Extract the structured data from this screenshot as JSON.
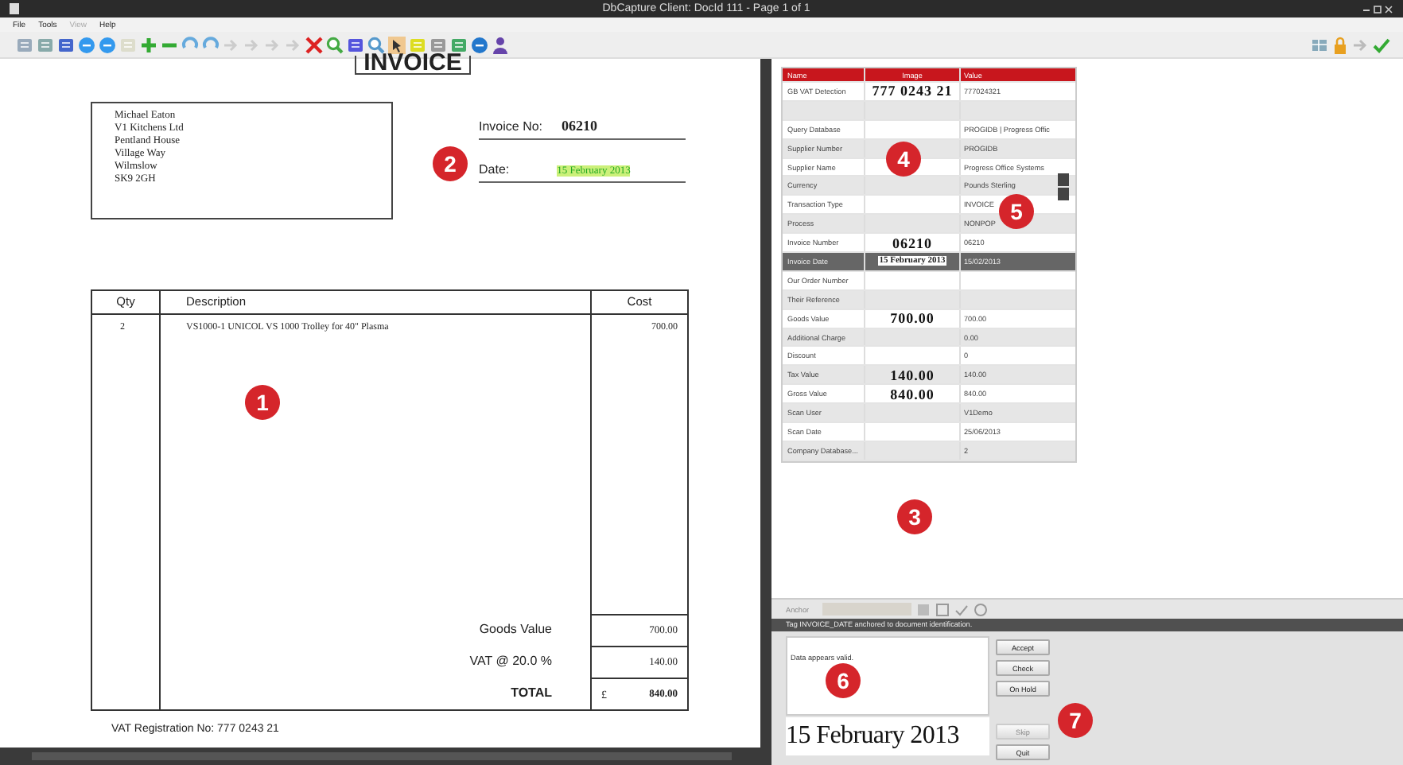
{
  "window": {
    "title": "DbCapture Client: DocId 111 - Page 1 of 1"
  },
  "menu": [
    {
      "label": "File",
      "disabled": false
    },
    {
      "label": "Tools",
      "disabled": false
    },
    {
      "label": "View",
      "disabled": true
    },
    {
      "label": "Help",
      "disabled": false
    }
  ],
  "invoice": {
    "heading": "INVOICE",
    "address": [
      "Michael Eaton",
      "V1 Kitchens Ltd",
      "Pentland House",
      "Village Way",
      "Wilmslow",
      "SK9 2GH"
    ],
    "invoice_no_label": "Invoice No:",
    "invoice_no": "06210",
    "date_label": "Date:",
    "date": "15 February 2013",
    "columns": [
      "Qty",
      "Description",
      "Cost"
    ],
    "rows": [
      {
        "qty": "2",
        "description": "VS1000-1  UNICOL VS 1000 Trolley for 40\" Plasma",
        "cost": "700.00"
      }
    ],
    "totals": [
      {
        "label": "Goods Value",
        "value": "700.00"
      },
      {
        "label": "VAT @ 20.0 %",
        "value": "140.00"
      },
      {
        "label": "TOTAL",
        "currency": "£",
        "value": "840.00"
      }
    ],
    "vat_registration": "VAT Registration No:  777 0243 21"
  },
  "grid": {
    "columns": [
      "Name",
      "Image",
      "Value"
    ],
    "rows": [
      {
        "name": "GB VAT Detection",
        "image": "777 0243 21",
        "value": "777024321",
        "selected": false
      },
      {
        "selected": false
      },
      {
        "name": "Query Database",
        "value": "PROGIDB  |  Progress Offic",
        "selected": false
      },
      {
        "name": "Supplier Number",
        "value": "PROGIDB",
        "selected": false
      },
      {
        "name": "Supplier Name",
        "value": "Progress Office Systems",
        "selected": false
      },
      {
        "name": "Currency",
        "value": "Pounds Sterling",
        "selected": false
      },
      {
        "name": "Transaction Type",
        "value": "INVOICE",
        "selected": false
      },
      {
        "name": "Process",
        "value": "NONPOP",
        "selected": false
      },
      {
        "name": "Invoice Number",
        "image": "06210",
        "value": "06210",
        "selected": false
      },
      {
        "name": "Invoice Date",
        "image": "15 February 2013",
        "value": "15/02/2013",
        "selected": true
      },
      {
        "name": "Our Order Number",
        "selected": false
      },
      {
        "name": "Their Reference",
        "selected": false
      },
      {
        "name": "Goods Value",
        "image": "700.00",
        "value": "700.00",
        "selected": false
      },
      {
        "name": "Additional Charge",
        "value": "0.00",
        "selected": false
      },
      {
        "name": "Discount",
        "value": "0",
        "selected": false
      },
      {
        "name": "Tax Value",
        "image": "140.00",
        "value": "140.00",
        "selected": false
      },
      {
        "name": "Gross Value",
        "image": "840.00",
        "value": "840.00",
        "selected": false
      },
      {
        "name": "Scan User",
        "value": "V1Demo",
        "selected": false
      },
      {
        "name": "Scan Date",
        "value": "25/06/2013",
        "selected": false
      },
      {
        "name": "Company Database...",
        "value": "2",
        "selected": false
      }
    ]
  },
  "anchor_label": "Anchor",
  "status": "Tag INVOICE_DATE anchored to document identification.",
  "message": "Data appears valid.",
  "snippet": "15 February 2013",
  "buttons": [
    {
      "label": "Accept",
      "disabled": false
    },
    {
      "label": "Check",
      "disabled": false
    },
    {
      "label": "On Hold",
      "disabled": false
    },
    {
      "label": "Skip",
      "disabled": true
    },
    {
      "label": "Quit",
      "disabled": false
    }
  ],
  "callouts": [
    "1",
    "2",
    "3",
    "4",
    "5",
    "6",
    "7"
  ]
}
